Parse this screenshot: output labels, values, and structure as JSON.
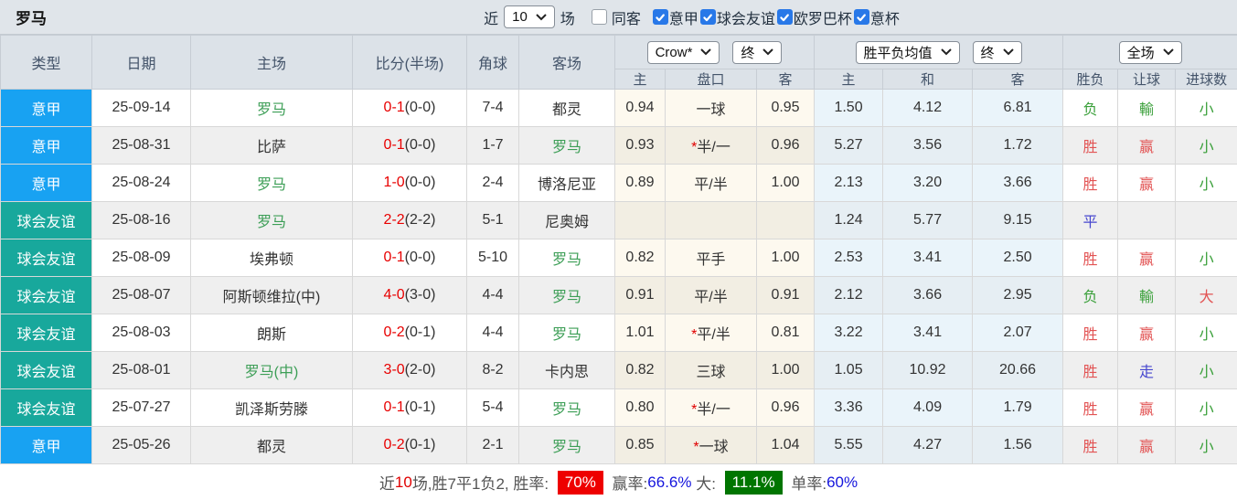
{
  "colors": {
    "league_blue": "#18a2f2",
    "friendly_teal": "#18a89c",
    "win_red": "#e25353",
    "lose_green": "#3ba03b",
    "draw_blue": "#4747cf",
    "score_red": "#e80000",
    "team_green": "#3c9e56",
    "badge_red": "#ee0000",
    "badge_green": "#007500",
    "pct_blue": "#1515dd",
    "checkbox_blue": "#2878e8"
  },
  "topbar": {
    "title": "罗马",
    "near_label": "近",
    "match_count": "10",
    "games_label": "场",
    "same_opponent_label": "同客",
    "same_opponent_checked": false,
    "filters": [
      {
        "label": "意甲",
        "checked": true
      },
      {
        "label": "球会友谊",
        "checked": true
      },
      {
        "label": "欧罗巴杯",
        "checked": true
      },
      {
        "label": "意杯",
        "checked": true
      }
    ]
  },
  "table": {
    "static_headers": [
      "类型",
      "日期",
      "主场",
      "比分(半场)",
      "角球",
      "客场"
    ],
    "group1": {
      "select1": "Crow*",
      "select2": "终",
      "sub": [
        "主",
        "盘口",
        "客"
      ]
    },
    "group2": {
      "select1": "胜平负均值",
      "select2": "终",
      "sub": [
        "主",
        "和",
        "客"
      ]
    },
    "group3": {
      "select1": "全场",
      "sub": [
        "胜负",
        "让球",
        "进球数"
      ]
    },
    "rows": [
      {
        "type": "意甲",
        "type_color": "blue",
        "date": "25-09-14",
        "home": "罗马",
        "home_color": "green",
        "score": "0-1",
        "half": "(0-0)",
        "corner": "7-4",
        "away": "都灵",
        "away_color": "dark",
        "odds_h": "0.94",
        "star": "",
        "handicap": "一球",
        "odds_a": "0.95",
        "avg_h": "1.50",
        "avg_d": "4.12",
        "avg_a": "6.81",
        "result": "负",
        "result_color": "green",
        "hres": "輸",
        "hres_color": "green",
        "goals": "小",
        "goals_color": "green"
      },
      {
        "type": "意甲",
        "type_color": "blue",
        "date": "25-08-31",
        "home": "比萨",
        "home_color": "dark",
        "score": "0-1",
        "half": "(0-0)",
        "corner": "1-7",
        "away": "罗马",
        "away_color": "green",
        "odds_h": "0.93",
        "star": "*",
        "handicap": "半/一",
        "odds_a": "0.96",
        "avg_h": "5.27",
        "avg_d": "3.56",
        "avg_a": "1.72",
        "result": "胜",
        "result_color": "red",
        "hres": "赢",
        "hres_color": "red",
        "goals": "小",
        "goals_color": "green"
      },
      {
        "type": "意甲",
        "type_color": "blue",
        "date": "25-08-24",
        "home": "罗马",
        "home_color": "green",
        "score": "1-0",
        "half": "(0-0)",
        "corner": "2-4",
        "away": "博洛尼亚",
        "away_color": "dark",
        "odds_h": "0.89",
        "star": "",
        "handicap": "平/半",
        "odds_a": "1.00",
        "avg_h": "2.13",
        "avg_d": "3.20",
        "avg_a": "3.66",
        "result": "胜",
        "result_color": "red",
        "hres": "赢",
        "hres_color": "red",
        "goals": "小",
        "goals_color": "green"
      },
      {
        "type": "球会友谊",
        "type_color": "teal",
        "date": "25-08-16",
        "home": "罗马",
        "home_color": "green",
        "score": "2-2",
        "half": "(2-2)",
        "corner": "5-1",
        "away": "尼奥姆",
        "away_color": "dark",
        "odds_h": "",
        "star": "",
        "handicap": "",
        "odds_a": "",
        "avg_h": "1.24",
        "avg_d": "5.77",
        "avg_a": "9.15",
        "result": "平",
        "result_color": "blue",
        "hres": "",
        "hres_color": "",
        "goals": "",
        "goals_color": ""
      },
      {
        "type": "球会友谊",
        "type_color": "teal",
        "date": "25-08-09",
        "home": "埃弗顿",
        "home_color": "dark",
        "score": "0-1",
        "half": "(0-0)",
        "corner": "5-10",
        "away": "罗马",
        "away_color": "green",
        "odds_h": "0.82",
        "star": "",
        "handicap": "平手",
        "odds_a": "1.00",
        "avg_h": "2.53",
        "avg_d": "3.41",
        "avg_a": "2.50",
        "result": "胜",
        "result_color": "red",
        "hres": "赢",
        "hres_color": "red",
        "goals": "小",
        "goals_color": "green"
      },
      {
        "type": "球会友谊",
        "type_color": "teal",
        "date": "25-08-07",
        "home": "阿斯顿维拉(中)",
        "home_color": "dark",
        "score": "4-0",
        "half": "(3-0)",
        "corner": "4-4",
        "away": "罗马",
        "away_color": "green",
        "odds_h": "0.91",
        "star": "",
        "handicap": "平/半",
        "odds_a": "0.91",
        "avg_h": "2.12",
        "avg_d": "3.66",
        "avg_a": "2.95",
        "result": "负",
        "result_color": "green",
        "hres": "輸",
        "hres_color": "green",
        "goals": "大",
        "goals_color": "red"
      },
      {
        "type": "球会友谊",
        "type_color": "teal",
        "date": "25-08-03",
        "home": "朗斯",
        "home_color": "dark",
        "score": "0-2",
        "half": "(0-1)",
        "corner": "4-4",
        "away": "罗马",
        "away_color": "green",
        "odds_h": "1.01",
        "star": "*",
        "handicap": "平/半",
        "odds_a": "0.81",
        "avg_h": "3.22",
        "avg_d": "3.41",
        "avg_a": "2.07",
        "result": "胜",
        "result_color": "red",
        "hres": "赢",
        "hres_color": "red",
        "goals": "小",
        "goals_color": "green"
      },
      {
        "type": "球会友谊",
        "type_color": "teal",
        "date": "25-08-01",
        "home": "罗马(中)",
        "home_color": "green",
        "score": "3-0",
        "half": "(2-0)",
        "corner": "8-2",
        "away": "卡内思",
        "away_color": "dark",
        "odds_h": "0.82",
        "star": "",
        "handicap": "三球",
        "odds_a": "1.00",
        "avg_h": "1.05",
        "avg_d": "10.92",
        "avg_a": "20.66",
        "result": "胜",
        "result_color": "red",
        "hres": "走",
        "hres_color": "blue",
        "goals": "小",
        "goals_color": "green"
      },
      {
        "type": "球会友谊",
        "type_color": "teal",
        "date": "25-07-27",
        "home": "凯泽斯劳滕",
        "home_color": "dark",
        "score": "0-1",
        "half": "(0-1)",
        "corner": "5-4",
        "away": "罗马",
        "away_color": "green",
        "odds_h": "0.80",
        "star": "*",
        "handicap": "半/一",
        "odds_a": "0.96",
        "avg_h": "3.36",
        "avg_d": "4.09",
        "avg_a": "1.79",
        "result": "胜",
        "result_color": "red",
        "hres": "赢",
        "hres_color": "red",
        "goals": "小",
        "goals_color": "green"
      },
      {
        "type": "意甲",
        "type_color": "blue",
        "date": "25-05-26",
        "home": "都灵",
        "home_color": "dark",
        "score": "0-2",
        "half": "(0-1)",
        "corner": "2-1",
        "away": "罗马",
        "away_color": "green",
        "odds_h": "0.85",
        "star": "*",
        "handicap": "一球",
        "odds_a": "1.04",
        "avg_h": "5.55",
        "avg_d": "4.27",
        "avg_a": "1.56",
        "result": "胜",
        "result_color": "red",
        "hres": "赢",
        "hres_color": "red",
        "goals": "小",
        "goals_color": "green"
      }
    ]
  },
  "footer": {
    "segments": [
      {
        "text": "近",
        "style": "plain"
      },
      {
        "text": "10",
        "style": "red-text"
      },
      {
        "text": "场,胜7平1负2, 胜率: ",
        "style": "plain"
      },
      {
        "text": "70%",
        "style": "badge-red"
      },
      {
        "text": " 赢率:",
        "style": "plain"
      },
      {
        "text": "66.6%",
        "style": "blue-text"
      },
      {
        "text": " 大: ",
        "style": "plain"
      },
      {
        "text": "11.1%",
        "style": "badge-green"
      },
      {
        "text": " 单率:",
        "style": "plain"
      },
      {
        "text": "60%",
        "style": "blue-text"
      }
    ]
  }
}
